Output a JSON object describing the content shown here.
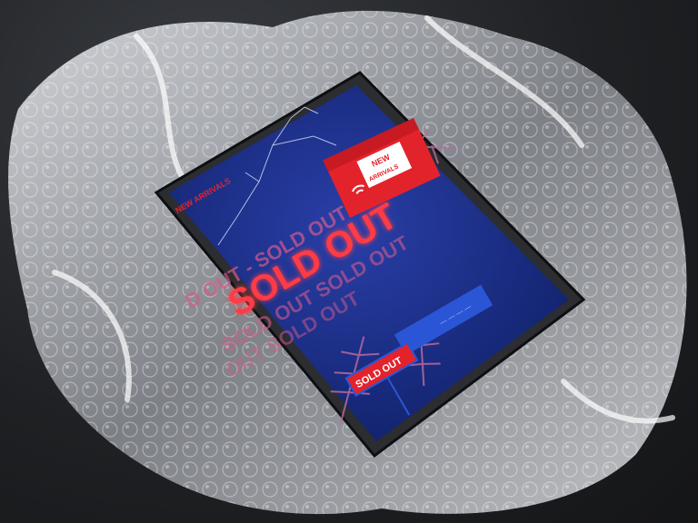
{
  "scene": {
    "background_color": "#1f2124",
    "wrap_color": "#dfe3ea",
    "tablet_frame_color": "#2b2d31",
    "screen_color": "#142a7a",
    "accent_red": "#e3232c",
    "glow_pink": "#ff5fa6"
  },
  "screen": {
    "header_text": "NEW ARRIVALS",
    "sold_out_main": "SOLD OUT",
    "repeat_line_1": "D OUT - SOLD OUT",
    "repeat_line_2": "SOLD OUT SOLD OUT",
    "repeat_line_3": "OUT SOLD OUT",
    "sign_label": "SOLD OUT",
    "sign_right_label": "— — — —"
  },
  "sticker": {
    "line_1": "NEW",
    "line_2": "ARRIVALS"
  }
}
